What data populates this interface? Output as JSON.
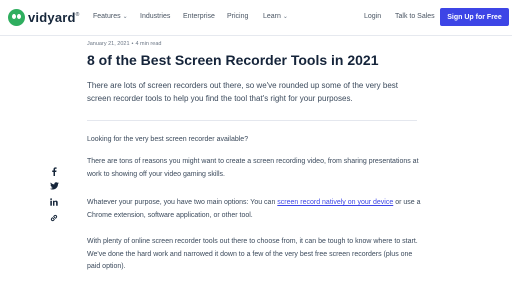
{
  "header": {
    "logo_text": "vidyard",
    "nav": [
      {
        "label": "Features",
        "has_dropdown": true
      },
      {
        "label": "Industries",
        "has_dropdown": false
      },
      {
        "label": "Enterprise",
        "has_dropdown": false
      },
      {
        "label": "Pricing",
        "has_dropdown": false
      },
      {
        "label": "Learn",
        "has_dropdown": true
      }
    ],
    "login": "Login",
    "talk_to_sales": "Talk to Sales",
    "signup": "Sign Up for Free"
  },
  "article": {
    "date": "January 21, 2021",
    "read_time": "4 min read",
    "title": "8 of the Best Screen Recorder Tools in 2021",
    "intro": "There are lots of screen recorders out there, so we've rounded up some of the very best screen recorder tools to help you find the tool that's right for your purposes.",
    "p1": "Looking for the very best screen recorder available?",
    "p2": "There are tons of reasons you might want to create a screen recording video, from sharing presentations at work to showing off your video gaming skills.",
    "p3_before": "Whatever your purpose, you have two main options: You can ",
    "p3_link": "screen record natively on your device",
    "p3_after": " or use a Chrome extension, software application, or other tool.",
    "p4": "With plenty of online screen recorder tools out there to choose from, it can be tough to know where to start. We've done the hard work and narrowed it down to a few of the very best free screen recorders (plus one paid option)."
  },
  "share": {
    "icons": [
      "facebook-icon",
      "twitter-icon",
      "linkedin-icon",
      "link-icon"
    ]
  },
  "colors": {
    "brand_green": "#2fae5f",
    "accent_blue": "#3d45e6",
    "heading": "#15243a",
    "body_text": "#3b4a5c"
  }
}
